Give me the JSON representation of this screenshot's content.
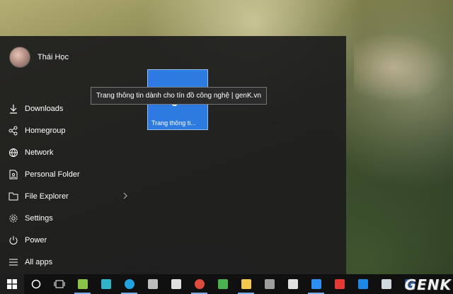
{
  "user": {
    "name": "Thái Học"
  },
  "menu": [
    {
      "label": "Downloads",
      "icon": "download-icon"
    },
    {
      "label": "Homegroup",
      "icon": "homegroup-icon"
    },
    {
      "label": "Network",
      "icon": "network-icon"
    },
    {
      "label": "Personal Folder",
      "icon": "personal-folder-icon"
    },
    {
      "label": "File Explorer",
      "icon": "file-explorer-icon",
      "has_submenu": true
    },
    {
      "label": "Settings",
      "icon": "gear-icon"
    },
    {
      "label": "Power",
      "icon": "power-icon"
    },
    {
      "label": "All apps",
      "icon": "all-apps-icon"
    }
  ],
  "tile": {
    "label": "Trang thông ti...",
    "color": "#2d7ae0"
  },
  "tooltip": {
    "text": "Trang thông tin dành cho tín đồ công nghệ | genK.vn"
  },
  "taskbar": {
    "apps": [
      {
        "name": "search",
        "icon": "cortana-icon",
        "color": "#ffffff"
      },
      {
        "name": "task-view",
        "icon": "task-view-icon",
        "color": "#ffffff"
      },
      {
        "name": "app-green",
        "icon": "green-app-icon",
        "color": "#8bc34a"
      },
      {
        "name": "app-tool",
        "icon": "tool-icon",
        "color": "#2fb4c9"
      },
      {
        "name": "skype",
        "icon": "skype-icon",
        "color": "#1fa3e0"
      },
      {
        "name": "app-link",
        "icon": "link-icon",
        "color": "#bdbdbd"
      },
      {
        "name": "store",
        "icon": "store-icon",
        "color": "#e0e0e0"
      },
      {
        "name": "chrome",
        "icon": "chrome-icon",
        "color": "#e04a3a"
      },
      {
        "name": "app-gv",
        "icon": "gv-icon",
        "color": "#4caf50"
      },
      {
        "name": "file-explorer",
        "icon": "folder-icon",
        "color": "#f2c94c"
      },
      {
        "name": "app-photo",
        "icon": "photo-icon",
        "color": "#9e9e9e"
      },
      {
        "name": "mail",
        "icon": "mail-icon",
        "color": "#e0e0e0"
      },
      {
        "name": "edge",
        "icon": "edge-icon",
        "color": "#2d8ff0"
      },
      {
        "name": "app-red",
        "icon": "red-app-icon",
        "color": "#e53935"
      },
      {
        "name": "app-blue",
        "icon": "blue-app-icon",
        "color": "#1e88e5"
      },
      {
        "name": "app-doc",
        "icon": "document-icon",
        "color": "#cfd8dc"
      },
      {
        "name": "word",
        "icon": "word-icon",
        "color": "#2b579a"
      }
    ]
  },
  "watermark": {
    "text": "GENK"
  }
}
